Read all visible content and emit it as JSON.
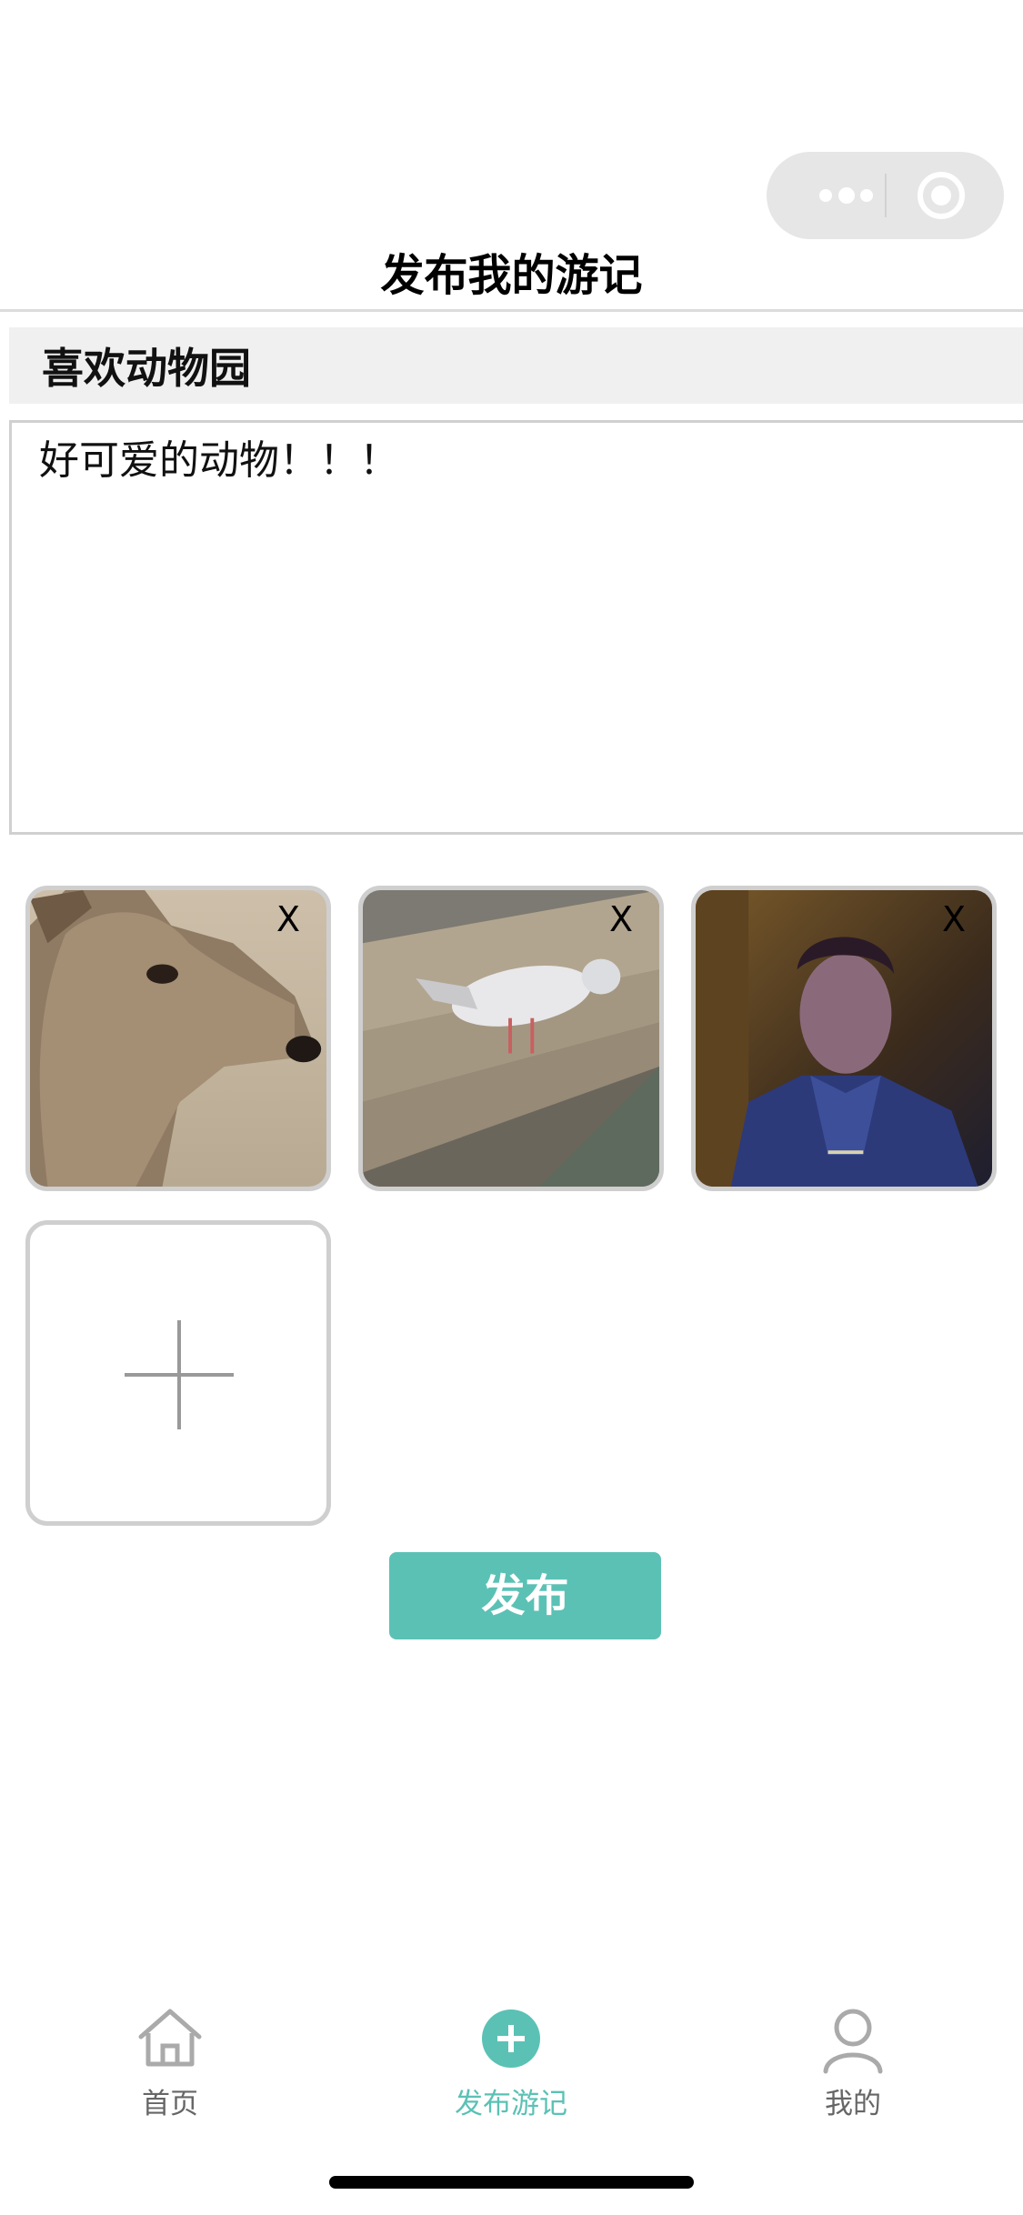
{
  "header": {
    "title": "发布我的游记"
  },
  "form": {
    "title_value": "喜欢动物园",
    "content_value": "好可爱的动物！！！"
  },
  "images": [
    {
      "name": "deer-photo",
      "delete_label": "X"
    },
    {
      "name": "pigeon-photo",
      "delete_label": "X"
    },
    {
      "name": "game-character-photo",
      "delete_label": "X"
    }
  ],
  "actions": {
    "publish_label": "发布"
  },
  "tabbar": {
    "items": [
      {
        "label": "首页",
        "icon": "home-icon"
      },
      {
        "label": "发布游记",
        "icon": "plus-circle-icon",
        "active": true
      },
      {
        "label": "我的",
        "icon": "user-icon"
      }
    ]
  },
  "colors": {
    "accent": "#5bc1b5",
    "border": "#cfcfcf",
    "input_bg": "#f0f0f0"
  }
}
